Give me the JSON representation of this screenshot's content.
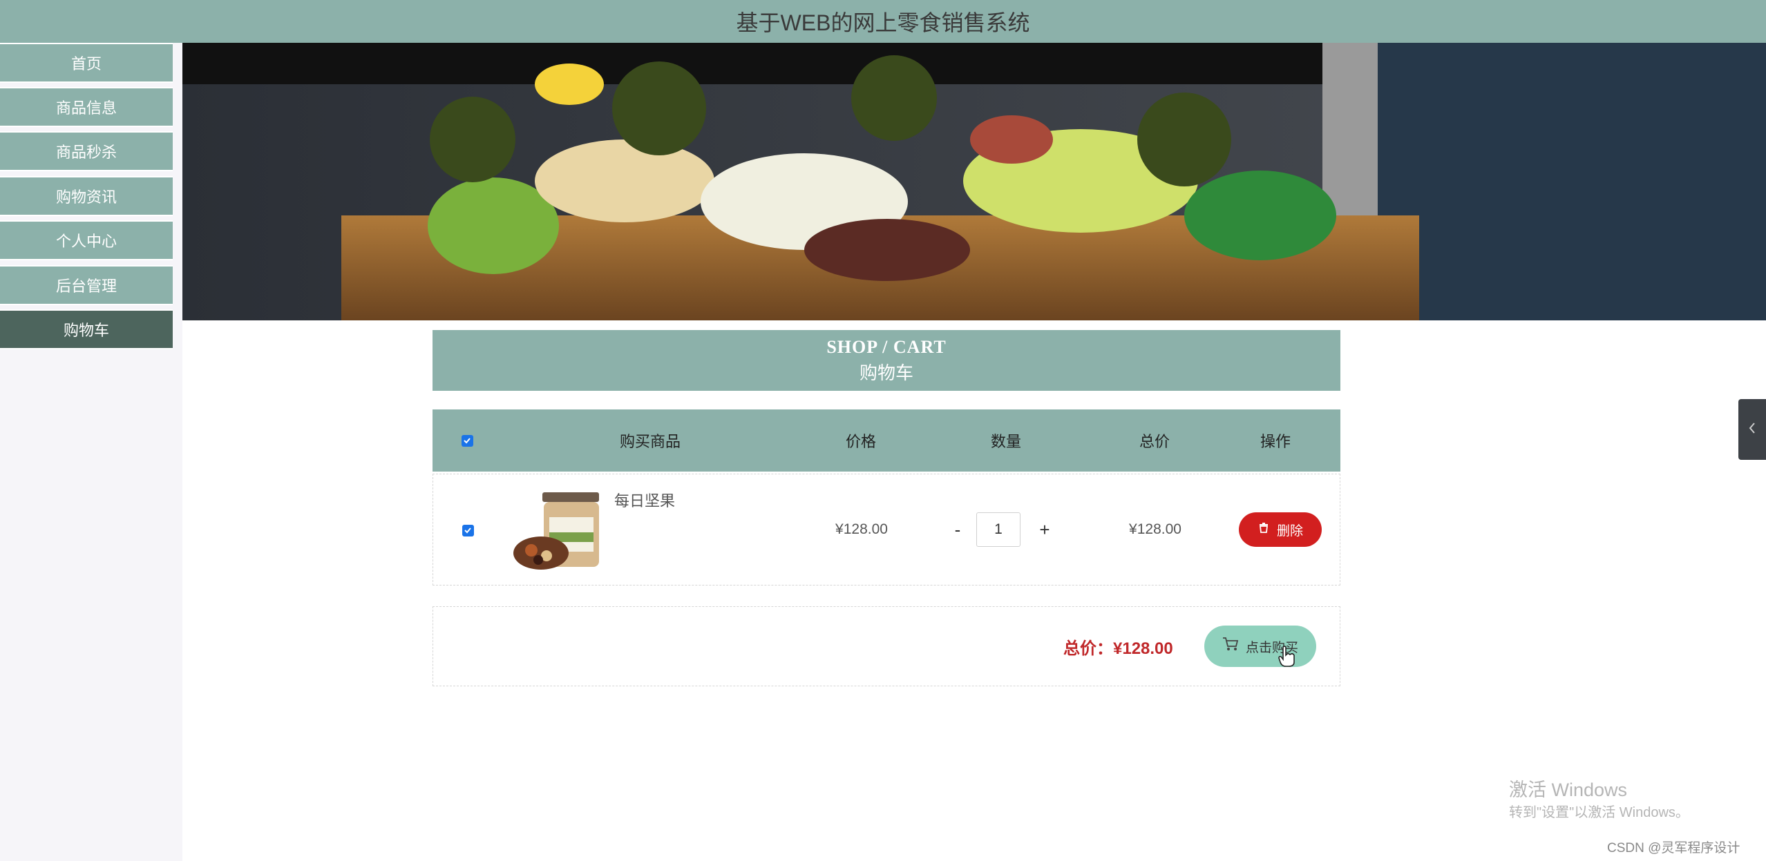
{
  "app": {
    "title": "基于WEB的网上零食销售系统"
  },
  "sidebar": {
    "items": [
      {
        "label": "首页",
        "active": false
      },
      {
        "label": "商品信息",
        "active": false
      },
      {
        "label": "商品秒杀",
        "active": false
      },
      {
        "label": "购物资讯",
        "active": false
      },
      {
        "label": "个人中心",
        "active": false
      },
      {
        "label": "后台管理",
        "active": false
      },
      {
        "label": "购物车",
        "active": true
      }
    ]
  },
  "banner": {
    "image": "food-banner"
  },
  "cart": {
    "title_en": "SHOP / CART",
    "title_cn": "购物车",
    "columns": [
      "购买商品",
      "价格",
      "数量",
      "总价",
      "操作"
    ],
    "select_all_checked": true,
    "items": [
      {
        "checked": true,
        "name": "每日坚果",
        "image": "nut-jar-product",
        "price": "¥128.00",
        "quantity": "1",
        "subtotal": "¥128.00",
        "decrease_label": "-",
        "increase_label": "+",
        "delete_label": "删除"
      }
    ],
    "summary": {
      "total_label": "总价：¥128.00",
      "buy_label": "点击购买"
    }
  },
  "overlay": {
    "windows_line1": "激活 Windows",
    "windows_line2": "转到\"设置\"以激活 Windows。",
    "credit": "CSDN @灵军程序设计"
  },
  "colors": {
    "primary": "#8cb1aa",
    "nav_active": "#4d655d",
    "delete": "#d21f1f",
    "buy": "#8fd1bd",
    "total_text": "#c0282a"
  }
}
